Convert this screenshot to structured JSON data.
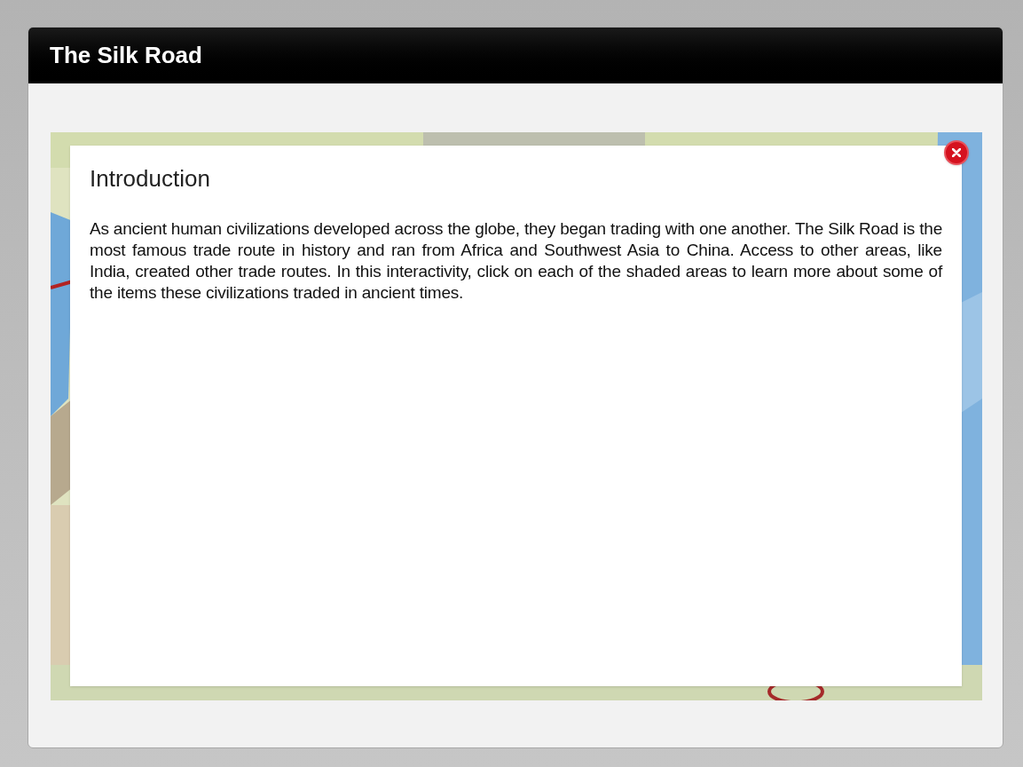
{
  "window": {
    "title": "The Silk Road"
  },
  "dialog": {
    "title": "Introduction",
    "body": "As ancient human civilizations developed across the globe, they began trading with one another.  The Silk Road is the most famous trade route in history and ran from Africa and Southwest Asia to China.  Access to other areas, like India, created other trade routes. In this interactivity, click on each of the shaded areas to learn more about some of the items these civilizations traded in ancient times."
  }
}
